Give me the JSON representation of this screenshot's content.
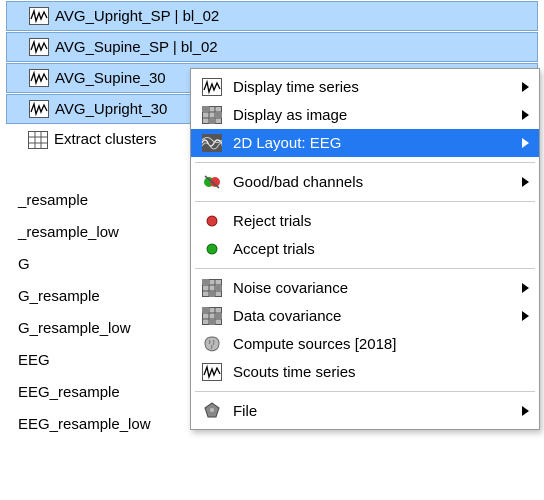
{
  "tree": {
    "rows": [
      {
        "label": "AVG_Upright_SP | bl_02",
        "icon": "wave",
        "selected": true
      },
      {
        "label": "AVG_Supine_SP | bl_02",
        "icon": "wave",
        "selected": true
      },
      {
        "label": "AVG_Supine_30",
        "icon": "wave",
        "selected": true
      },
      {
        "label": "AVG_Upright_30",
        "icon": "wave",
        "selected": true
      },
      {
        "label": "Extract clusters",
        "icon": "table",
        "selected": false
      }
    ]
  },
  "behind": {
    "items": [
      "_resample",
      "_resample_low",
      "G",
      "G_resample",
      "G_resample_low",
      "EEG",
      "EEG_resample",
      "EEG_resample_low"
    ]
  },
  "menu": {
    "groups": [
      [
        {
          "label": "Display time series",
          "icon": "wave",
          "submenu": true
        },
        {
          "label": "Display as image",
          "icon": "grid",
          "submenu": true
        },
        {
          "label": "2D Layout: EEG",
          "icon": "layout",
          "submenu": true,
          "highlight": true
        }
      ],
      [
        {
          "label": "Good/bad channels",
          "icon": "goodbad",
          "submenu": true
        }
      ],
      [
        {
          "label": "Reject trials",
          "icon": "red-dot",
          "submenu": false
        },
        {
          "label": "Accept trials",
          "icon": "green-dot",
          "submenu": false
        }
      ],
      [
        {
          "label": "Noise covariance",
          "icon": "grid",
          "submenu": true
        },
        {
          "label": "Data covariance",
          "icon": "grid",
          "submenu": true
        },
        {
          "label": "Compute sources [2018]",
          "icon": "brain",
          "submenu": false
        },
        {
          "label": "Scouts time series",
          "icon": "wave",
          "submenu": false
        }
      ],
      [
        {
          "label": "File",
          "icon": "file",
          "submenu": true
        }
      ]
    ]
  }
}
